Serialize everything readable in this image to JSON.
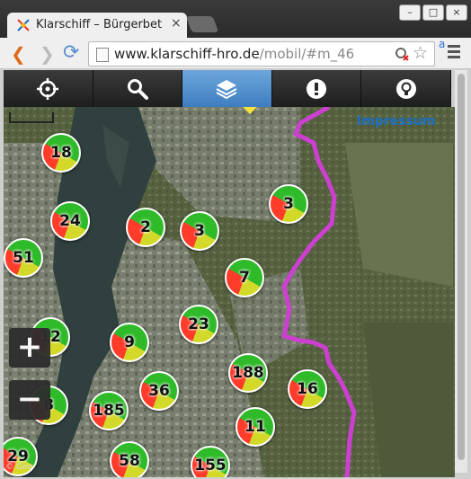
{
  "browser": {
    "tab_title": "Klarschiff – Bürgerbet",
    "tab_close": "×",
    "url_host": "www.klarschiff-hro.de",
    "url_path": "/mobil/#m_46",
    "account_label": "a",
    "window_buttons": [
      "–",
      "□",
      "×"
    ]
  },
  "app": {
    "toolbar": [
      {
        "icon": "locate-icon"
      },
      {
        "icon": "search-icon"
      },
      {
        "icon": "layers-icon",
        "active": true
      },
      {
        "icon": "alert-icon"
      },
      {
        "icon": "lightbulb-icon"
      }
    ],
    "impressum": "Impressum",
    "zoom_in": "+",
    "zoom_out": "−",
    "attribution": "© Geo"
  },
  "markers": [
    "18",
    "3",
    "24",
    "2",
    "3",
    "51",
    "7",
    "23",
    "12",
    "9",
    "188",
    "36",
    "16",
    "8",
    "185",
    "11",
    "29",
    "58",
    "155"
  ],
  "colors": {
    "route": "#cc3fd0",
    "active_tab": "#4f8fd0",
    "impressum": "#1b6fc6"
  }
}
